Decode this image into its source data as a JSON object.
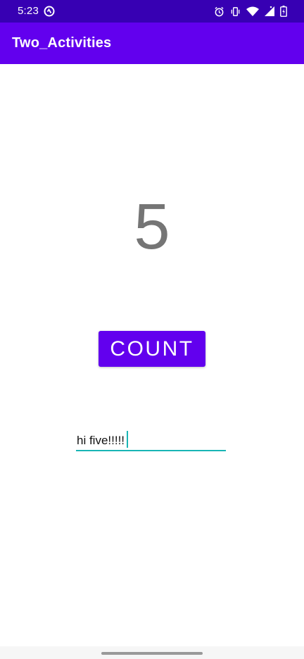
{
  "status_bar": {
    "time": "5:23",
    "icons": [
      "sync-icon",
      "alarm-icon",
      "vibrate-icon",
      "wifi-icon",
      "signal-icon",
      "battery-icon"
    ],
    "background_color": "#3700b3"
  },
  "app_bar": {
    "title": "Two_Activities",
    "background_color": "#6200ee"
  },
  "main": {
    "count_value": "5",
    "count_button_label": "COUNT",
    "edit_text_value": "hi five!!!!!",
    "accent_color": "#19b5b5"
  }
}
